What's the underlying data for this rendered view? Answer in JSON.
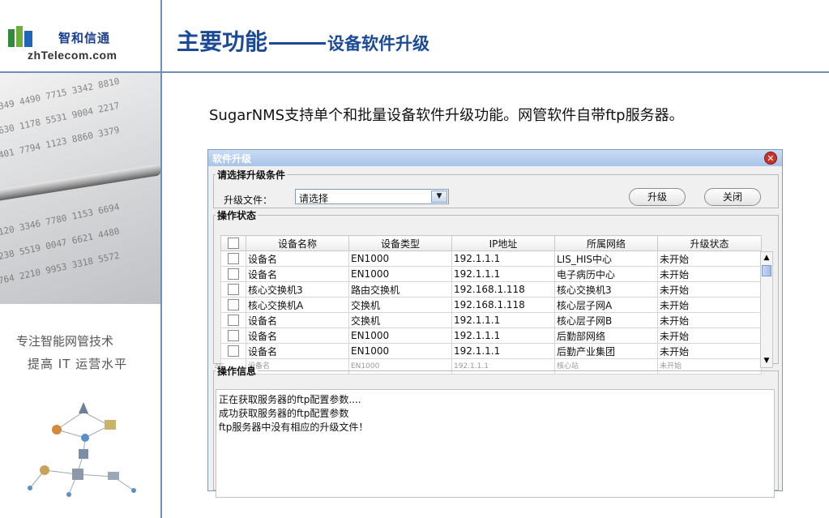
{
  "brand": {
    "name_cn": "智和信通",
    "domain": "zhTelecom.com",
    "slogan_line1": "专注智能网管技术",
    "slogan_line2": "提高 IT 运营水平"
  },
  "header": {
    "title_main": "主要功能",
    "title_sub": "设备软件升级"
  },
  "intro": "SugarNMS支持单个和批量设备软件升级功能。网管软件自带ftp服务器。",
  "dialog": {
    "title": "软件升级",
    "condition_group": {
      "legend": "请选择升级条件",
      "file_label": "升级文件：",
      "file_value": "请选择",
      "upgrade_button": "升级",
      "close_button": "关闭"
    },
    "status_group": {
      "legend": "操作状态",
      "columns": [
        "设备名称",
        "设备类型",
        "IP地址",
        "所属网络",
        "升级状态"
      ],
      "rows": [
        [
          "设备名",
          "EN1000",
          "192.1.1.1",
          "LIS_HIS中心",
          "未开始"
        ],
        [
          "设备名",
          "EN1000",
          "192.1.1.1",
          "电子病历中心",
          "未开始"
        ],
        [
          "核心交换机3",
          "路由交换机",
          "192.168.1.118",
          "核心交换机3",
          "未开始"
        ],
        [
          "核心交换机A",
          "交换机",
          "192.168.1.118",
          "核心层子网A",
          "未开始"
        ],
        [
          "设备名",
          "交换机",
          "192.1.1.1",
          "核心层子网B",
          "未开始"
        ],
        [
          "设备名",
          "EN1000",
          "192.1.1.1",
          "后勤部网络",
          "未开始"
        ],
        [
          "设备名",
          "EN1000",
          "192.1.1.1",
          "后勤产业集团",
          "未开始"
        ]
      ],
      "partial_row": [
        "设备名",
        "EN1000",
        "192.1.1.1",
        "核心站",
        "未开始"
      ]
    },
    "info_group": {
      "legend": "操作信息",
      "lines": [
        "正在获取服务器的ftp配置参数....",
        "成功获取服务器的ftp配置参数",
        "ftp服务器中没有相应的升级文件！"
      ]
    }
  },
  "colors": {
    "title_blue": "#1b4a98",
    "rule_blue": "#6e8fb8",
    "dialog_border": "#7f9db9",
    "close_red": "#c8342a"
  },
  "icons": {
    "close": "close-icon",
    "dropdown": "chevron-down-icon",
    "scroll_up": "arrow-up-icon",
    "scroll_down": "arrow-down-icon"
  }
}
